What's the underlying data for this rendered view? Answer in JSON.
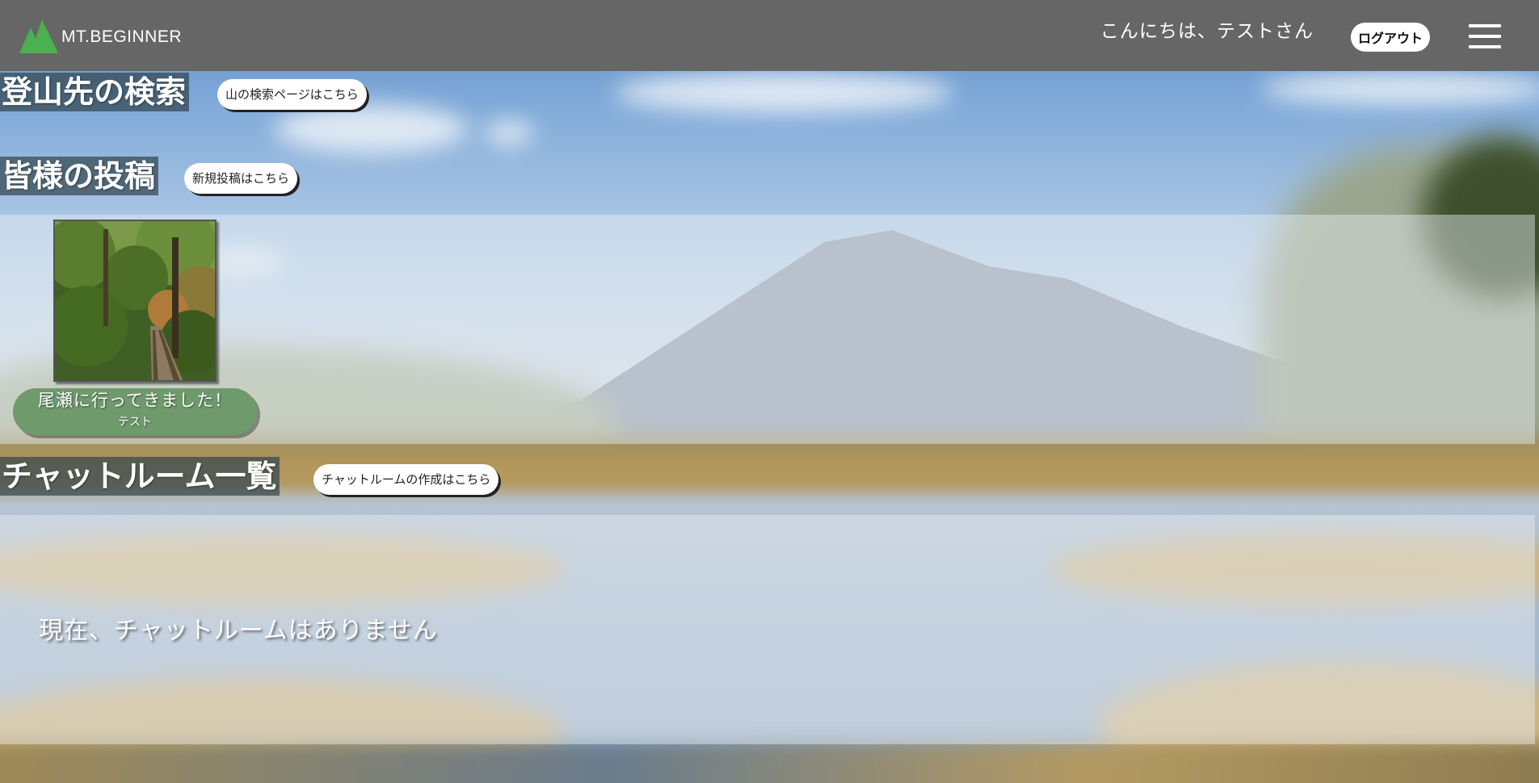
{
  "app": {
    "logo_text": "MT.BEGINNER",
    "brand_color": "#4caf50"
  },
  "header": {
    "greeting": "こんにちは、テストさん",
    "logout_label": "ログアウト",
    "menu_icon": "hamburger-menu-icon",
    "background_color": "#666666"
  },
  "search_section": {
    "title": "登山先の検索",
    "button_label": "山の検索ページはこちら"
  },
  "posts_section": {
    "title": "皆様の投稿",
    "button_label": "新規投稿はこちら",
    "posts": [
      {
        "title": "尾瀬に行ってきました！",
        "user": "テスト",
        "image": "forest-boardwalk-photo"
      }
    ]
  },
  "chat_section": {
    "title": "チャットルーム一覧",
    "button_label": "チャットルームの作成はこちら",
    "empty_message": "現在、チャットルームはありません"
  }
}
